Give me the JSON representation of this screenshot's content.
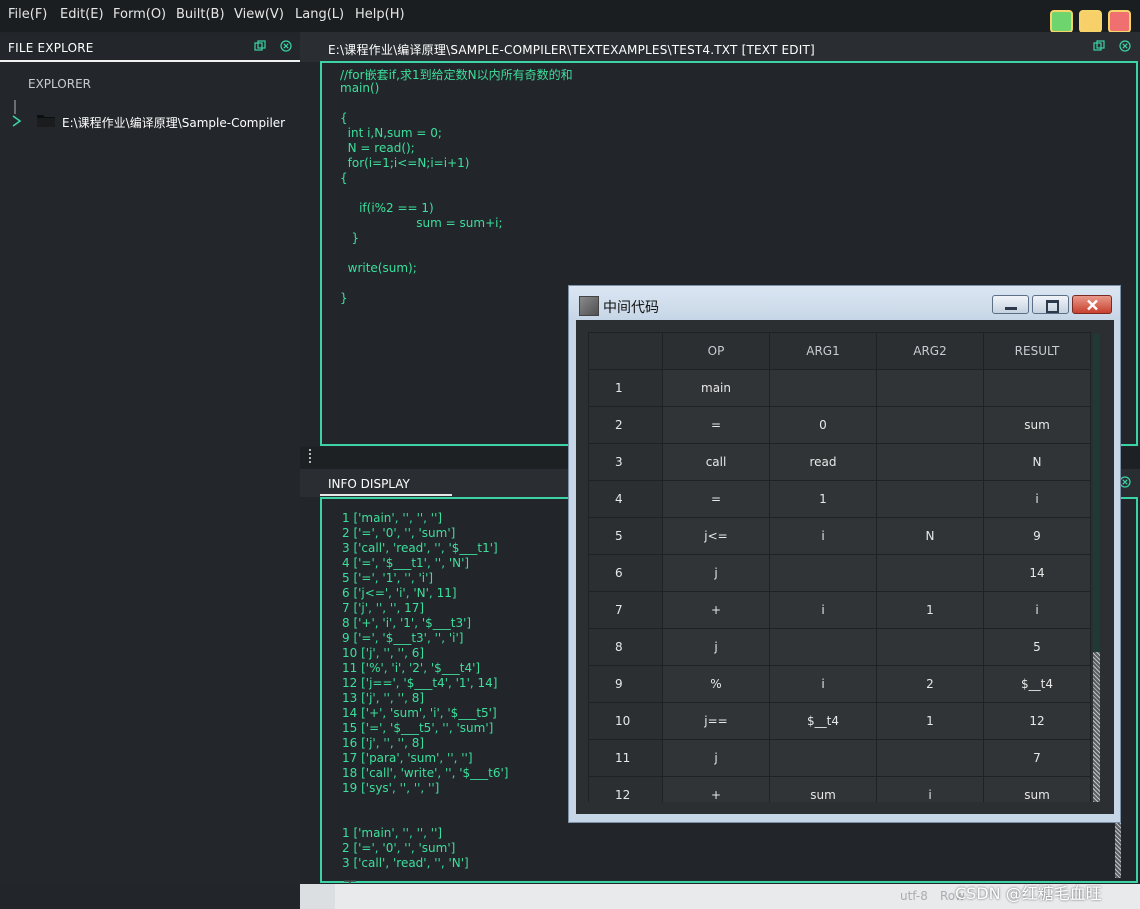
{
  "menu": [
    "File(F)",
    "Edit(E)",
    "Form(O)",
    "Built(B)",
    "View(V)",
    "Lang(L)",
    "Help(H)"
  ],
  "window_controls": {
    "green": "#6ed46e",
    "yellow": "#f7d06a",
    "red": "#f07070"
  },
  "explorer": {
    "title": "FILE EXPLORE",
    "heading": "EXPLORER",
    "root_path": "E:\\课程作业\\编译原理\\Sample-Compiler"
  },
  "editor": {
    "title": "E:\\课程作业\\编译原理\\SAMPLE-COMPILER\\TEXTEXAMPLES\\TEST4.TXT  [TEXT EDIT]",
    "lines": [
      "//for嵌套if,求1到给定数N以内所有奇数的和",
      "main()",
      "",
      "{",
      "  int i,N,sum = 0;",
      "  N = read();",
      "  for(i=1;i<=N;i=i+1)",
      "{",
      "",
      "     if(i%2 == 1)",
      "                    sum = sum+i;",
      "   }",
      "",
      "  write(sum);",
      "",
      "}"
    ]
  },
  "info": {
    "title": "INFO DISPLAY",
    "lines": [
      "1 ['main', '', '', '']",
      "2 ['=', '0', '', 'sum']",
      "3 ['call', 'read', '', '$___t1']",
      "4 ['=', '$___t1', '', 'N']",
      "5 ['=', '1', '', 'i']",
      "6 ['j<=', 'i', 'N', 11]",
      "7 ['j', '', '', 17]",
      "8 ['+', 'i', '1', '$___t3']",
      "9 ['=', '$___t3', '', 'i']",
      "10 ['j', '', '', 6]",
      "11 ['%', 'i', '2', '$___t4']",
      "12 ['j==', '$___t4', '1', 14]",
      "13 ['j', '', '', 8]",
      "14 ['+', 'sum', 'i', '$___t5']",
      "15 ['=', '$___t5', '', 'sum']",
      "16 ['j', '', '', 8]",
      "17 ['para', 'sum', '', '']",
      "18 ['call', 'write', '', '$___t6']",
      "19 ['sys', '', '', '']",
      "",
      "",
      "1 ['main', '', '', '']",
      "2 ['=', '0', '', 'sum']",
      "3 ['call', 'read', '', 'N']"
    ]
  },
  "status": {
    "encoding": "utf-8",
    "row": "Row",
    "watermark": "CSDN @红糖毛血旺"
  },
  "dialog": {
    "title": "中间代码",
    "app_icon": "qt-icon",
    "columns": [
      "",
      "OP",
      "ARG1",
      "ARG2",
      "RESULT"
    ],
    "rows": [
      [
        "1",
        "main",
        "",
        "",
        ""
      ],
      [
        "2",
        "=",
        "0",
        "",
        "sum"
      ],
      [
        "3",
        "call",
        "read",
        "",
        "N"
      ],
      [
        "4",
        "=",
        "1",
        "",
        "i"
      ],
      [
        "5",
        "j<=",
        "i",
        "N",
        "9"
      ],
      [
        "6",
        "j",
        "",
        "",
        "14"
      ],
      [
        "7",
        "+",
        "i",
        "1",
        "i"
      ],
      [
        "8",
        "j",
        "",
        "",
        "5"
      ],
      [
        "9",
        "%",
        "i",
        "2",
        "$__t4"
      ],
      [
        "10",
        "j==",
        "$__t4",
        "1",
        "12"
      ],
      [
        "11",
        "j",
        "",
        "",
        "7"
      ],
      [
        "12",
        "+",
        "sum",
        "i",
        "sum"
      ]
    ]
  }
}
